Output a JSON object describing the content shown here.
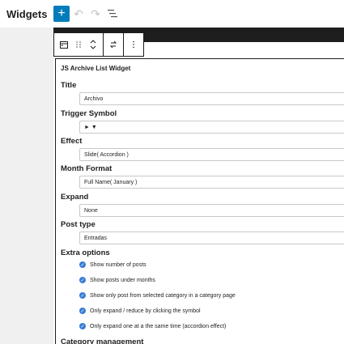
{
  "header": {
    "title": "Widgets",
    "add_label": "+"
  },
  "widget": {
    "title": "JS Archive List Widget",
    "fields": {
      "title": {
        "label": "Title",
        "value": "Archivo"
      },
      "trigger_symbol": {
        "label": "Trigger Symbol",
        "value": "► ▼"
      },
      "effect": {
        "label": "Effect",
        "value": "Slide( Accordion )"
      },
      "month_format": {
        "label": "Month Format",
        "value": "Full Name( January )"
      },
      "expand": {
        "label": "Expand",
        "value": "None"
      },
      "post_type": {
        "label": "Post type",
        "value": "Entradas"
      }
    },
    "extra_options": {
      "label": "Extra options",
      "items": [
        "Show number of posts",
        "Show posts under months",
        "Show only post from selected category in a category page",
        "Only expand / reduce by clicking the symbol",
        "Only expand one at a the same time (accordion effect)"
      ]
    },
    "category_management_label": "Category management"
  },
  "colors": {
    "accent": "#007cba",
    "checkbox": "#3a7bd5",
    "dark": "#1e1e1e"
  }
}
